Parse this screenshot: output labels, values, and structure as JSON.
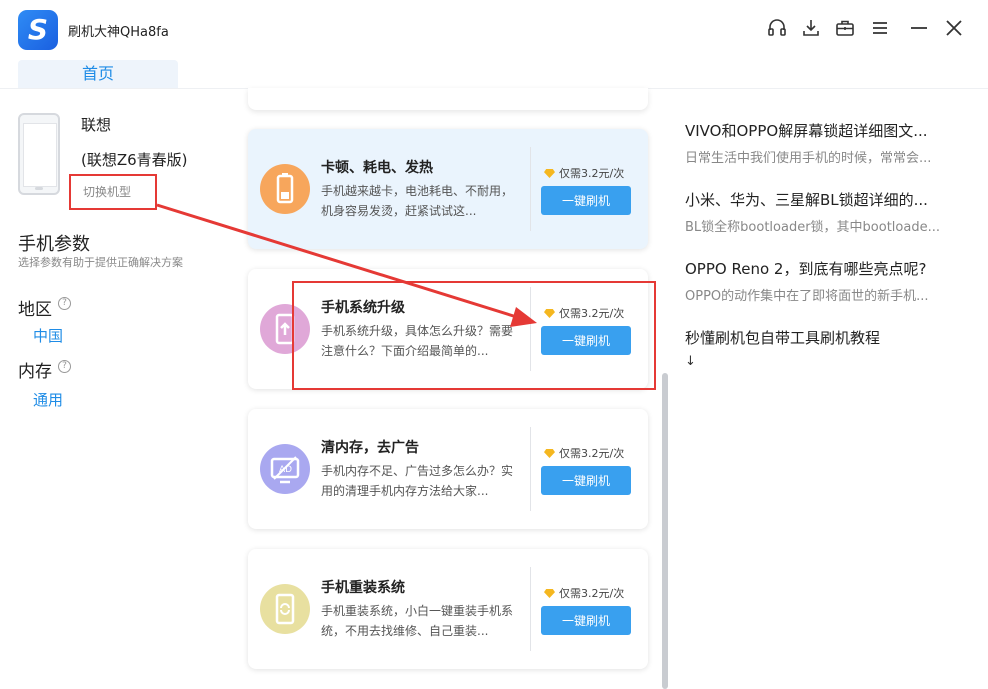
{
  "app": {
    "title": "刷机大神QHa8fa",
    "logo_letter": "S"
  },
  "window_controls": [
    {
      "name": "headset-icon",
      "glyph": "🎧"
    },
    {
      "name": "download-icon",
      "glyph": "⤓"
    },
    {
      "name": "toolbox-icon",
      "glyph": "🧰"
    },
    {
      "name": "menu-icon",
      "glyph": "☰"
    },
    {
      "name": "minimize-icon",
      "glyph": "—"
    },
    {
      "name": "close-icon",
      "glyph": "✕"
    }
  ],
  "tabs": {
    "home": "首页"
  },
  "device": {
    "brand": "联想",
    "model": "(联想Z6青春版)",
    "switch_label": "切换机型"
  },
  "params": {
    "title": "手机参数",
    "subtitle": "选择参数有助于提供正确解决方案",
    "region_label": "地区",
    "region_value": "中国",
    "memory_label": "内存",
    "memory_value": "通用",
    "help_glyph": "?"
  },
  "cards": [
    {
      "title": "卡顿、耗电、发热",
      "desc": "手机越来越卡，电池耗电、不耐用，机身容易发烫，赶紧试试这...",
      "price": "仅需3.2元/次",
      "button": "一键刷机",
      "icon": "battery-icon",
      "icon_color": "#f7a65c"
    },
    {
      "title": "手机系统升级",
      "desc": "手机系统升级，具体怎么升级？需要注意什么？下面介绍最简单的...",
      "price": "仅需3.2元/次",
      "button": "一键刷机",
      "icon": "phone-upgrade-icon",
      "icon_color": "#e0a8d8"
    },
    {
      "title": "清内存，去广告",
      "desc": "手机内存不足、广告过多怎么办？实用的清理手机内存方法给大家...",
      "price": "仅需3.2元/次",
      "button": "一键刷机",
      "icon": "ad-block-icon",
      "icon_color": "#a9a8f0"
    },
    {
      "title": "手机重装系统",
      "desc": "手机重装系统，小白一键重装手机系统，不用去找维修、自己重装...",
      "price": "仅需3.2元/次",
      "button": "一键刷机",
      "icon": "reinstall-icon",
      "icon_color": "#e8e0a0"
    }
  ],
  "articles": [
    {
      "title": "VIVO和OPPO解屏幕锁超详细图文...",
      "sub": "日常生活中我们使用手机的时候，常常会..."
    },
    {
      "title": "小米、华为、三星解BL锁超详细的...",
      "sub": "BL锁全称bootloader锁，其中bootloade..."
    },
    {
      "title": "OPPO Reno 2，到底有哪些亮点呢?",
      "sub": "OPPO的动作集中在了即将面世的新手机..."
    },
    {
      "title": "秒懂刷机包自带工具刷机教程",
      "sub": "↓"
    }
  ],
  "colors": {
    "accent": "#1f8ce6",
    "button": "#39a0ef",
    "annotation": "#e53935"
  }
}
